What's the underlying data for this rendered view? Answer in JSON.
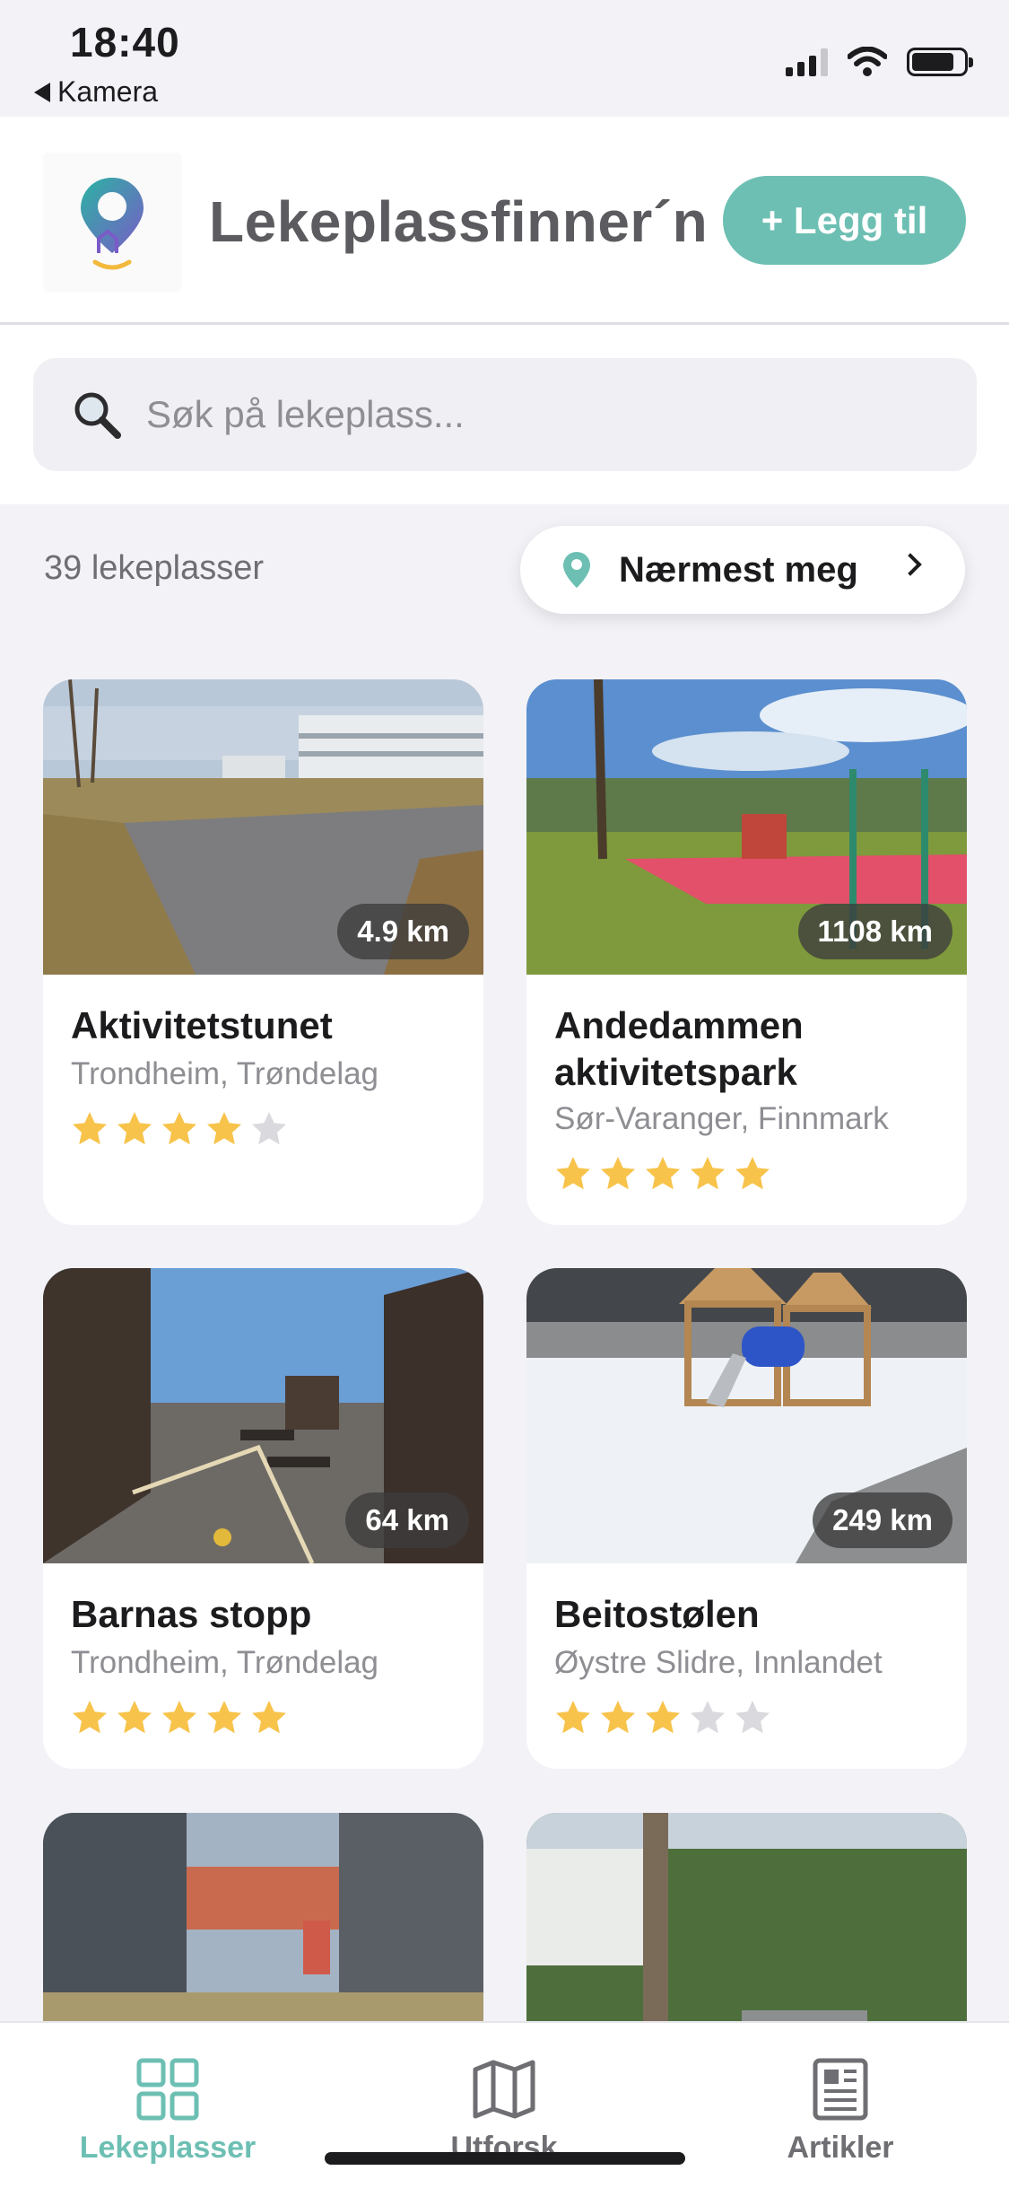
{
  "status_bar": {
    "time": "18:40",
    "back_label": "Kamera"
  },
  "header": {
    "title": "Lekeplassfinner´n",
    "add_button": "+ Legg til"
  },
  "search": {
    "placeholder": "Søk på lekeplass..."
  },
  "list": {
    "count_label": "39 lekeplasser",
    "sort_label": "Nærmest meg"
  },
  "playgrounds": [
    {
      "name": "Aktivitetstunet",
      "location": "Trondheim, Trøndelag",
      "distance": "4.9 km",
      "rating": 4
    },
    {
      "name": "Andedammen aktivitetspark",
      "location": "Sør-Varanger, Finnmark",
      "distance": "1108 km",
      "rating": 5
    },
    {
      "name": "Barnas stopp",
      "location": "Trondheim, Trøndelag",
      "distance": "64 km",
      "rating": 5
    },
    {
      "name": "Beitostølen",
      "location": "Øystre Slidre, Innlandet",
      "distance": "249 km",
      "rating": 3
    }
  ],
  "tabs": [
    {
      "label": "Lekeplasser",
      "icon": "grid-icon",
      "active": true
    },
    {
      "label": "Utforsk",
      "icon": "map-icon",
      "active": false
    },
    {
      "label": "Artikler",
      "icon": "newspaper-icon",
      "active": false
    }
  ],
  "colors": {
    "accent": "#6dbfb3",
    "star": "#f7c34a",
    "star_empty": "#d9d9de",
    "tab_inactive": "#6e6e73"
  }
}
